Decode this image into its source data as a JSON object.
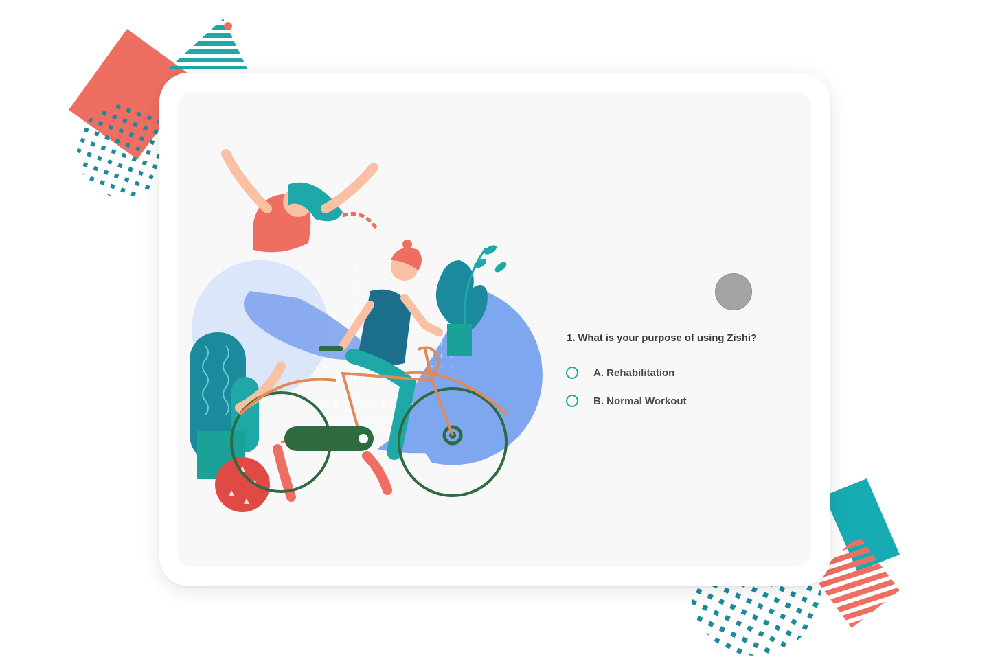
{
  "colors": {
    "coral": "#ef6e62",
    "teal": "#1fa8a8",
    "deep_teal": "#1b8a9c",
    "radio_ring": "#1fa8a8",
    "home_button": "#a3a3a3",
    "screen_bg": "#f8f8f8"
  },
  "survey": {
    "question": "1. What is your purpose of using Zishi?",
    "options": [
      {
        "label": "A. Rehabilitation",
        "selected": false
      },
      {
        "label": "B. Normal Workout",
        "selected": false
      }
    ]
  },
  "illustration": {
    "name": "woman-cycling-and-woman-dancing-scene"
  }
}
